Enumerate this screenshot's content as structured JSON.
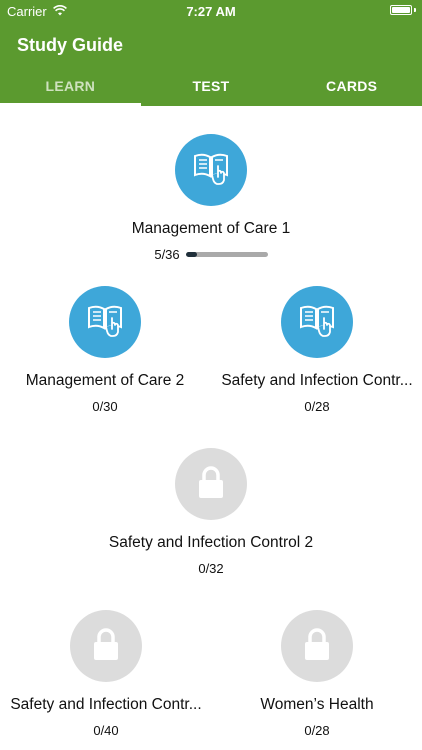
{
  "status_bar": {
    "carrier": "Carrier",
    "time": "7:27 AM"
  },
  "app_bar": {
    "title": "Study Guide"
  },
  "tabs": [
    {
      "label": "LEARN",
      "active": true
    },
    {
      "label": "TEST",
      "active": false
    },
    {
      "label": "CARDS",
      "active": false
    }
  ],
  "topics": [
    {
      "title": "Management of Care 1",
      "progress": "5/36",
      "completed": 5,
      "total": 36,
      "locked": false
    },
    {
      "title": "Management of Care 2",
      "progress": "0/30",
      "locked": false
    },
    {
      "title": "Safety and Infection Contr...",
      "progress": "0/28",
      "locked": false
    },
    {
      "title": "Safety and Infection Control 2",
      "progress": "0/32",
      "locked": true
    },
    {
      "title": "Safety and Infection Contr...",
      "progress": "0/40",
      "locked": true
    },
    {
      "title": "Women’s Health",
      "progress": "0/28",
      "locked": true
    }
  ],
  "colors": {
    "primary": "#5b9a2f",
    "unlocked_circle": "#3ea7d9",
    "locked_circle": "#dcdcdc",
    "progress_fill": "#1f2f3a"
  }
}
